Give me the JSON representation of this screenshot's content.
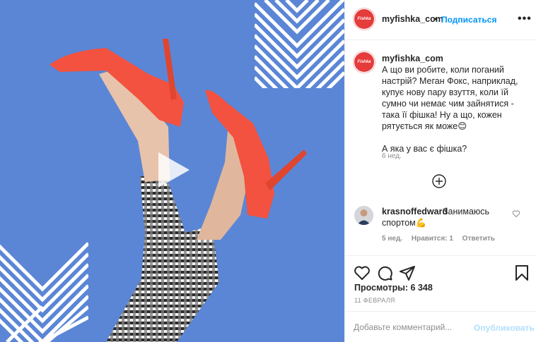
{
  "account": {
    "username": "myfishka_com",
    "logo_text": "Fishka"
  },
  "header": {
    "separator": "•",
    "follow_label": "Подписаться",
    "more_label": "•••"
  },
  "caption": {
    "username": "myfishka_com",
    "text": "А що ви робите, коли поганий настрій? Меган Фокс, наприклад, купує нову пару взуття, коли їй сумно чи немає чим зайнятися - така її фішка! Ну а що, кожен рятується як може😊\n\nА яка у вас є фішка?",
    "time": "6 нед."
  },
  "comments": [
    {
      "username": "krasnoffedward",
      "text_first": "Занимаюсь",
      "text_second": "спортом💪",
      "time": "5 нед.",
      "likes": "Нравится: 1",
      "reply_label": "Ответить"
    }
  ],
  "stats": {
    "views": "Просмотры: 6 348",
    "date": "11 ФЕВРАЛЯ"
  },
  "comment_box": {
    "placeholder": "Добавьте комментарий...",
    "publish_label": "Опубликовать"
  },
  "colors": {
    "accent": "#0095f6",
    "media_bg": "#5b86d6",
    "shoe": "#f2523f",
    "brand": "#e53b3b"
  },
  "icons": [
    "play-icon",
    "heart-icon",
    "comment-icon",
    "share-icon",
    "bookmark-icon",
    "plus-circle-icon",
    "more-icon"
  ]
}
